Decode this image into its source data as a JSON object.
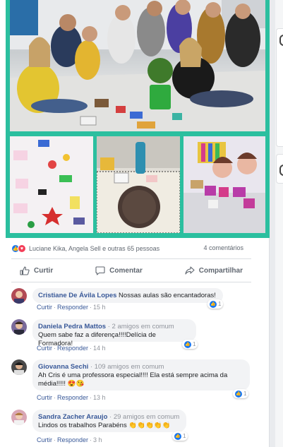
{
  "post": {
    "reactions_text": "Luciane Kika, Angela Sell e outras 65 pessoas",
    "comments_count": "4 comentários",
    "actions": {
      "like": "Curtir",
      "comment": "Comentar",
      "share": "Compartilhar"
    }
  },
  "comments": [
    {
      "author": "Cristiane De Ávila Lopes",
      "mutual": "",
      "text": "Nossas aulas são encantadoras!",
      "like_label": "Curtir",
      "reply_label": "Responder",
      "time": "15 h",
      "likes": "1"
    },
    {
      "author": "Daniela Pedra Mattos",
      "mutual": "2 amigos em comum",
      "text": "Quem sabe faz a diferença!!!!Delícia de Formadora!",
      "like_label": "Curtir",
      "reply_label": "Responder",
      "time": "14 h",
      "likes": "1"
    },
    {
      "author": "Giovanna Sechi",
      "mutual": "109 amigos em comum",
      "text": "Ah Cris é uma professora especial!!!! Ela está sempre acima da média!!!!! 😍😘",
      "like_label": "Curtir",
      "reply_label": "Responder",
      "time": "13 h",
      "likes": "1"
    },
    {
      "author": "Sandra Zacher Araujo",
      "mutual": "29 amigos em comum",
      "text": "Lindos os trabalhos Parabéns 👏👏👏👏👏",
      "like_label": "Curtir",
      "reply_label": "Responder",
      "time": "3 h",
      "likes": "1"
    }
  ],
  "colors": {
    "accent": "#1877f2",
    "link": "#385898",
    "photo_frame": "#2bbf9f"
  },
  "icons": {
    "like": "thumbs-up-icon",
    "comment": "speech-bubble-icon",
    "share": "share-arrow-icon"
  }
}
